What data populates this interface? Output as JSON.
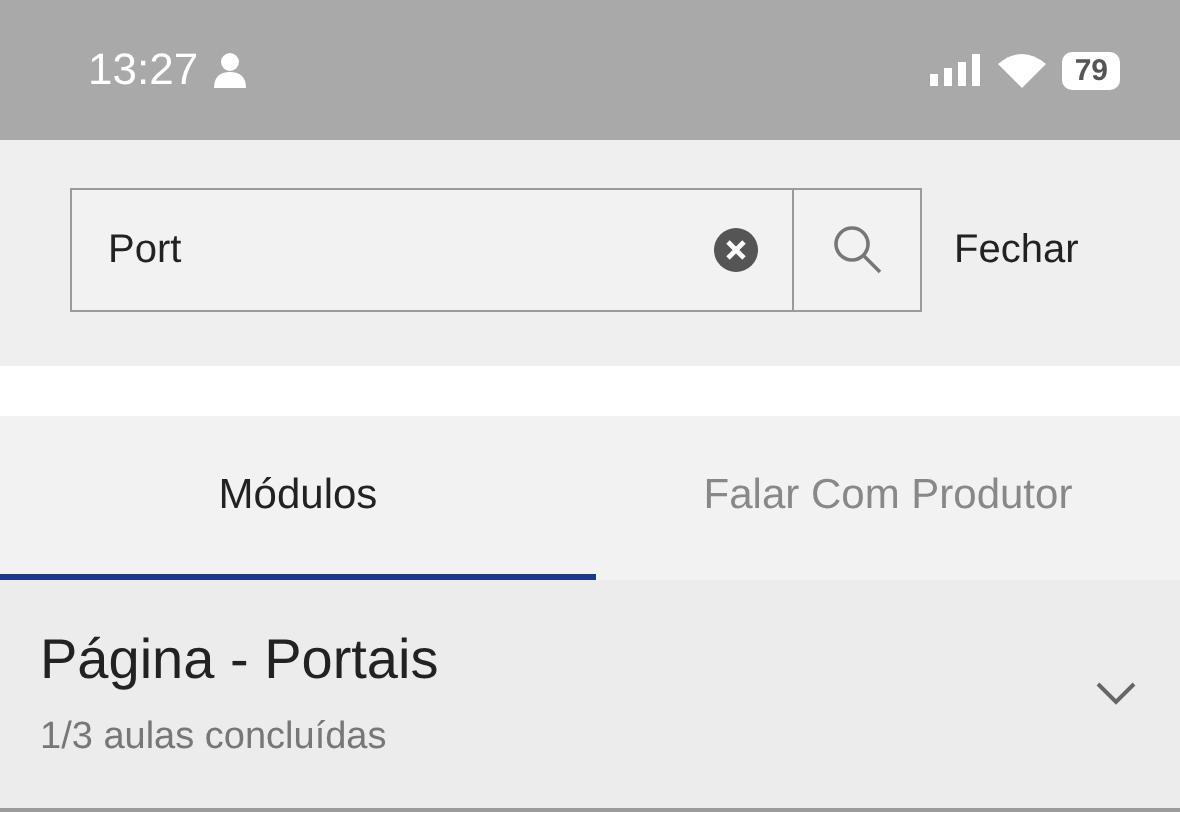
{
  "status_bar": {
    "time": "13:27",
    "battery": "79"
  },
  "search": {
    "value": "Port"
  },
  "close_label": "Fechar",
  "tabs": [
    {
      "label": "Módulos",
      "selected": true
    },
    {
      "label": "Falar Com Produtor",
      "selected": false
    }
  ],
  "modules": [
    {
      "title": "Página - Portais",
      "progress": "1/3 aulas concluídas",
      "expanded": false
    }
  ]
}
